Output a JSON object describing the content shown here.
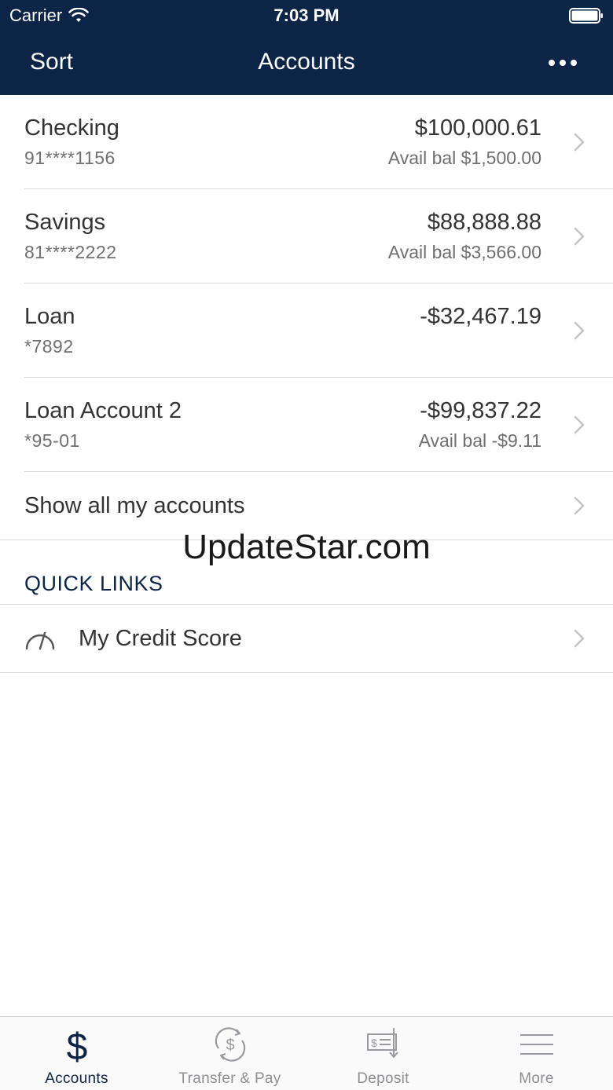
{
  "status_bar": {
    "carrier": "Carrier",
    "time": "7:03 PM"
  },
  "nav": {
    "sort_label": "Sort",
    "title": "Accounts",
    "more_icon": "more-dots-icon"
  },
  "accounts": [
    {
      "name": "Checking",
      "number": "91****1156",
      "balance": "$100,000.61",
      "avail": "Avail bal $1,500.00"
    },
    {
      "name": "Savings",
      "number": "81****2222",
      "balance": "$88,888.88",
      "avail": "Avail bal $3,566.00"
    },
    {
      "name": "Loan",
      "number": "*7892",
      "balance": "-$32,467.19",
      "avail": ""
    },
    {
      "name": "Loan Account 2",
      "number": "*95-01",
      "balance": "-$99,837.22",
      "avail": "Avail bal -$9.11"
    }
  ],
  "show_all_label": "Show all my accounts",
  "watermark": "UpdateStar.com",
  "quick_links": {
    "header": "QUICK LINKS",
    "items": [
      {
        "label": "My Credit Score",
        "icon": "gauge-icon"
      }
    ]
  },
  "tabs": [
    {
      "label": "Accounts",
      "icon": "dollar-icon",
      "active": true
    },
    {
      "label": "Transfer & Pay",
      "icon": "transfer-icon",
      "active": false
    },
    {
      "label": "Deposit",
      "icon": "deposit-check-icon",
      "active": false
    },
    {
      "label": "More",
      "icon": "menu-icon",
      "active": false
    }
  ],
  "colors": {
    "header_bg": "#0c2446",
    "tab_active": "#0c2446",
    "tab_inactive": "#8e8e93",
    "divider": "#dcdcdc"
  }
}
